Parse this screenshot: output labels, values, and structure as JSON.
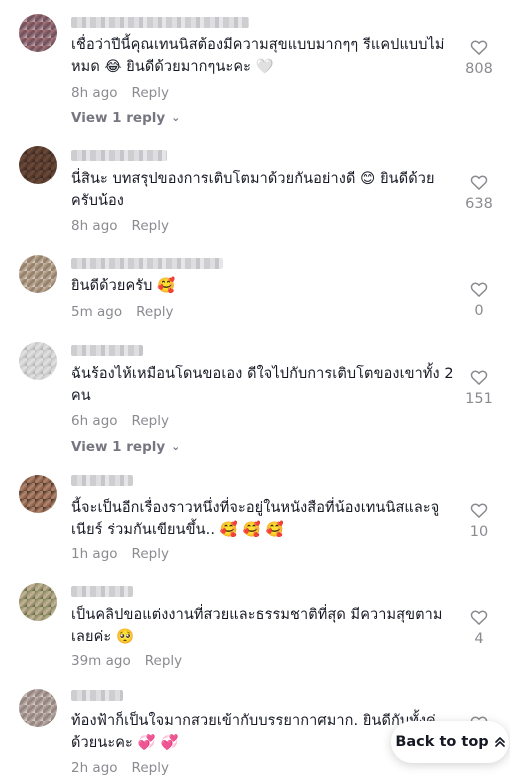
{
  "comments": [
    {
      "text": "เชื่อว่าปีนี้คุณเทนนิสต้องมีความสุขแบบมากๆๆ รีแคปแบบไม่หมด 😂 ยินดีด้วยมากๆนะคะ 🤍",
      "time": "8h ago",
      "reply": "Reply",
      "likes": "808",
      "view_replies": "View 1 reply"
    },
    {
      "text": "นี่สินะ บทสรุปของการเติบโตมาด้วยกันอย่างดี 😊 ยินดีด้วยครับน้อง",
      "time": "8h ago",
      "reply": "Reply",
      "likes": "638"
    },
    {
      "text": "ยินดีด้วยครับ 🥰",
      "time": "5m ago",
      "reply": "Reply",
      "likes": "0"
    },
    {
      "text": "ฉันร้องไห้เหมือนโดนขอเอง ดีใจไปกับการเติบโตของเขาทั้ง 2 คน",
      "time": "6h ago",
      "reply": "Reply",
      "likes": "151",
      "view_replies": "View 1 reply"
    },
    {
      "text": "นี้จะเป็นอีกเรื่องราวหนึ่งที่จะอยู่ในหนังสือที่น้องเทนนิสและจูเนียร์ ร่วมกันเขียนขึ้น.. 🥰 🥰 🥰",
      "time": "1h ago",
      "reply": "Reply",
      "likes": "10"
    },
    {
      "text": "เป็นคลิปขอแต่งงานที่สวยและธรรมชาติที่สุด มีความสุขตามเลยค่ะ 🥺",
      "time": "39m ago",
      "reply": "Reply",
      "likes": "4"
    },
    {
      "text": "ท้องฟ้าก็เป็นใจมากสวยเข้ากับบรรยากาศมาก. ยินดีกับทั้งคู่ด้วยนะคะ 💞 💞",
      "time": "2h ago",
      "reply": "Reply",
      "likes": ""
    }
  ],
  "back_to_top": "Back to top",
  "icons": {
    "like": "heart-outline-icon",
    "chevron": "chevron-down-icon",
    "back_to_top": "double-chevron-up-icon"
  }
}
